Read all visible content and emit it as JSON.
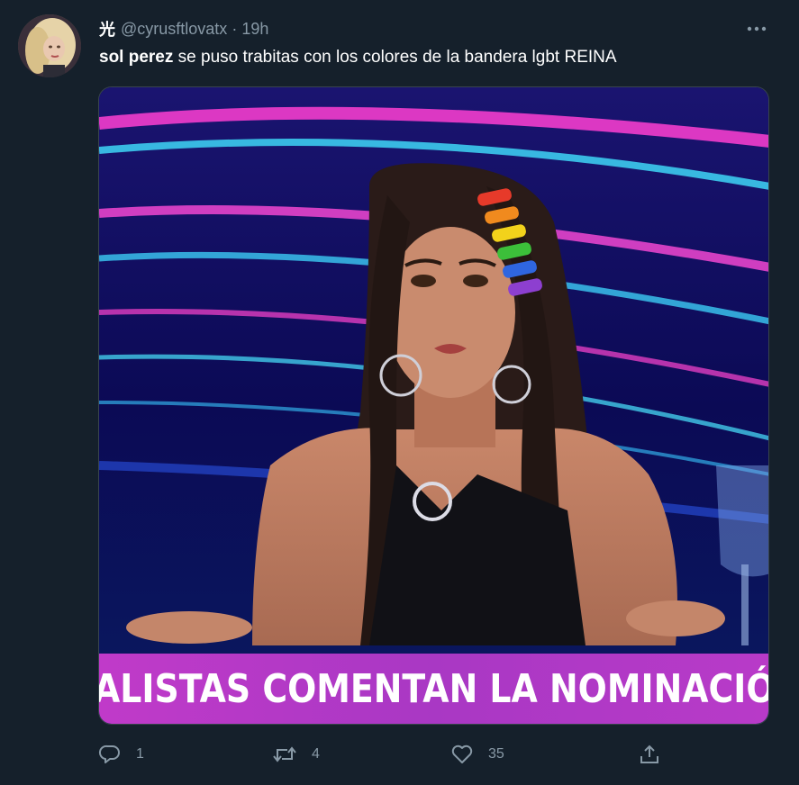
{
  "tweet": {
    "display_name": "光",
    "handle": "@cyrusftlovatx",
    "separator": "·",
    "time": "19h",
    "text_bold": "sol perez",
    "text_rest": " se puso trabitas con los colores de la bandera lgbt REINA"
  },
  "media": {
    "banner_text": "ALISTAS COMENTAN LA NOMINACIÓN ESPO"
  },
  "actions": {
    "reply_count": "1",
    "retweet_count": "4",
    "like_count": "35"
  },
  "icons": {
    "more": "more-horizontal-icon",
    "reply": "reply-icon",
    "retweet": "retweet-icon",
    "like": "heart-icon",
    "share": "share-icon"
  },
  "colors": {
    "background": "#15202b",
    "secondary_text": "#8899a6",
    "primary_text": "#ffffff",
    "banner": "#b43ac6"
  }
}
